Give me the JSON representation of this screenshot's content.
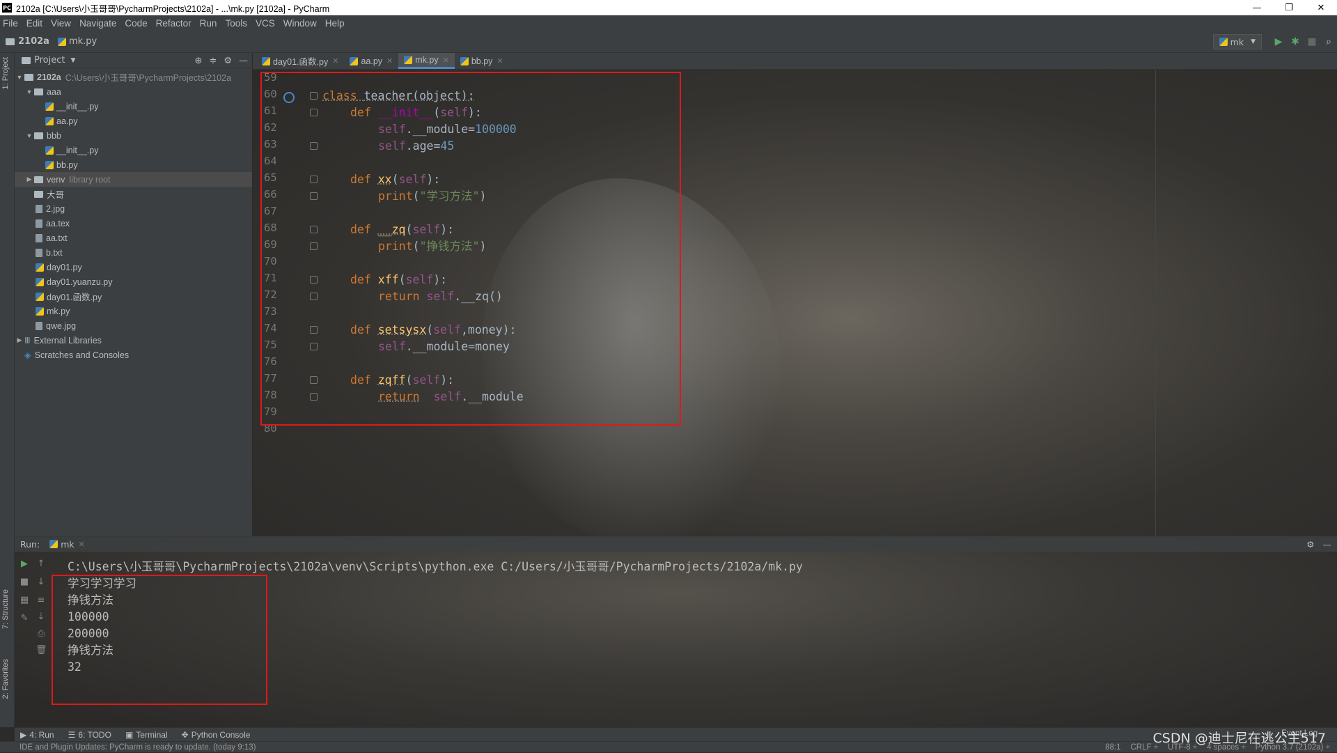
{
  "window": {
    "title": "2102a [C:\\Users\\小玉哥哥\\PycharmProjects\\2102a] - ...\\mk.py [2102a] - PyCharm",
    "app_icon": "PC"
  },
  "menu": [
    "File",
    "Edit",
    "View",
    "Navigate",
    "Code",
    "Refactor",
    "Run",
    "Tools",
    "VCS",
    "Window",
    "Help"
  ],
  "breadcrumb": {
    "project": "2102a",
    "file": "mk.py"
  },
  "run_config": "mk",
  "side_tabs": {
    "project": "1: Project",
    "structure": "7: Structure",
    "favorites": "2: Favorites"
  },
  "project_panel": {
    "title": "Project",
    "tree": [
      {
        "label": "2102a",
        "hint": "C:\\Users\\小玉哥哥\\PycharmProjects\\2102a",
        "type": "folder",
        "arrow": "▼",
        "bold": true
      },
      {
        "label": "aaa",
        "type": "folder",
        "arrow": "▼"
      },
      {
        "label": "__init__.py",
        "type": "py"
      },
      {
        "label": "aa.py",
        "type": "py"
      },
      {
        "label": "bbb",
        "type": "folder",
        "arrow": "▼"
      },
      {
        "label": "__init__.py",
        "type": "py"
      },
      {
        "label": "bb.py",
        "type": "py"
      },
      {
        "label": "venv",
        "hint": "library root",
        "type": "folder",
        "arrow": "▶",
        "selected": true
      },
      {
        "label": "大哥",
        "type": "folder"
      },
      {
        "label": "2.jpg",
        "type": "file"
      },
      {
        "label": "aa.tex",
        "type": "file"
      },
      {
        "label": "aa.txt",
        "type": "file"
      },
      {
        "label": "b.txt",
        "type": "file"
      },
      {
        "label": "day01.py",
        "type": "py"
      },
      {
        "label": "day01.yuanzu.py",
        "type": "py"
      },
      {
        "label": "day01.函数.py",
        "type": "py"
      },
      {
        "label": "mk.py",
        "type": "py"
      },
      {
        "label": "qwe.jpg",
        "type": "file"
      },
      {
        "label": "External Libraries",
        "type": "lib",
        "arrow": "▶"
      },
      {
        "label": "Scratches and Consoles",
        "type": "scratch"
      }
    ]
  },
  "tabs": [
    {
      "label": "day01.函数.py",
      "active": false
    },
    {
      "label": "aa.py",
      "active": false
    },
    {
      "label": "mk.py",
      "active": true
    },
    {
      "label": "bb.py",
      "active": false
    }
  ],
  "line_numbers": [
    "59",
    "60",
    "61",
    "62",
    "63",
    "64",
    "65",
    "66",
    "67",
    "68",
    "69",
    "70",
    "71",
    "72",
    "73",
    "74",
    "75",
    "76",
    "77",
    "78",
    "79",
    "80"
  ],
  "code": {
    "l60": {
      "kw": "class",
      "name": "teacher",
      "rest": "(object):"
    },
    "l61": {
      "kw": "def",
      "name": "__init__",
      "p1": "(",
      "self": "self",
      "p2": "):"
    },
    "l62": {
      "self": "self",
      "attr": ".__module=",
      "num": "100000"
    },
    "l63": {
      "self": "self",
      "attr": ".age=",
      "num": "45"
    },
    "l65": {
      "kw": "def",
      "name": "xx",
      "p1": "(",
      "self": "self",
      "p2": "):"
    },
    "l66": {
      "fn": "print",
      "p1": "(",
      "str": "\"学习方法\"",
      "p2": ")"
    },
    "l68": {
      "kw": "def",
      "name": "__zq",
      "p1": "(",
      "self": "self",
      "p2": "):"
    },
    "l69": {
      "fn": "print",
      "p1": "(",
      "str": "\"挣钱方法\"",
      "p2": ")"
    },
    "l71": {
      "kw": "def",
      "name": "xff",
      "p1": "(",
      "self": "self",
      "p2": "):"
    },
    "l72": {
      "kw": "return",
      "self": "self",
      "attr": ".__zq()"
    },
    "l74": {
      "kw": "def",
      "name": "setsysx",
      "p1": "(",
      "self": "self",
      "p2": ",money):"
    },
    "l75": {
      "self": "self",
      "attr": ".__module=money"
    },
    "l77": {
      "kw": "def",
      "name": "zqff",
      "p1": "(",
      "self": "self",
      "p2": "):"
    },
    "l78": {
      "kw": "return",
      "self": "self",
      "attr": ".__module"
    }
  },
  "run_panel": {
    "label": "Run:",
    "tab": "mk",
    "command": "C:\\Users\\小玉哥哥\\PycharmProjects\\2102a\\venv\\Scripts\\python.exe C:/Users/小玉哥哥/PycharmProjects/2102a/mk.py",
    "output": [
      "学习学习学习",
      "挣钱方法",
      "100000",
      "200000",
      "挣钱方法",
      "32"
    ]
  },
  "bottom_tabs": [
    "4: Run",
    "6: TODO",
    "Terminal",
    "Python Console"
  ],
  "event_log": "Event Log",
  "status": {
    "message": "IDE and Plugin Updates: PyCharm is ready to update. (today 9:13)",
    "position": "88:1",
    "line_sep": "CRLF ÷",
    "encoding": "UTF-8 ÷",
    "indent": "4 spaces ÷",
    "interpreter": "Python 3.7 (2102a) ÷"
  },
  "watermark": "CSDN @迪士尼在逃公主517",
  "colors": {
    "highlight_box": "#e0191a",
    "keyword": "#cc7832",
    "self": "#94558d",
    "number": "#6897bb",
    "string": "#6a8759"
  }
}
